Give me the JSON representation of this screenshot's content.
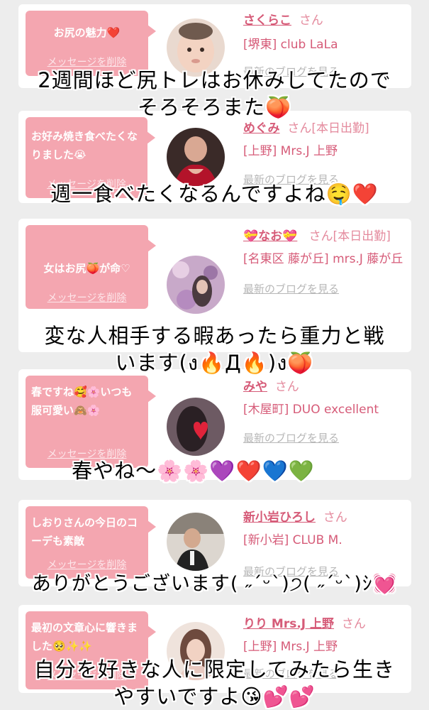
{
  "cards": [
    {
      "message": "お尻の魅力❤️",
      "delete_label": "メッセージを削除",
      "name": "さくらこ",
      "honorific": "さん",
      "shop": "[堺東] club LaLa",
      "blog_link": "最新のブログを見る",
      "avatar": "baby-photo",
      "overlay": "2週間ほど尻トレはお休みしてたので\nそろそろまた🍑"
    },
    {
      "message": "お好み焼き食べたくなりました😭",
      "delete_label": "メッセージを削除",
      "name": "めぐみ",
      "honorific": "さん[本日出勤]",
      "shop": "[上野] Mrs.J 上野",
      "blog_link": "最新のブログを見る",
      "avatar": "red-dress-photo",
      "overlay": "週一食べたくなるんですよね🤤❤️"
    },
    {
      "message": "女はお尻🍑が命♡",
      "delete_label": "メッセージを削除",
      "name": "💝なお💝",
      "honorific": "さん[本日出勤]",
      "shop": "[名東区 藤が丘] mrs.J 藤が丘",
      "blog_link": "最新のブログを見る",
      "avatar": "flower-photo",
      "overlay": "変な人相手する暇あったら重力と戦\nいます(ง🔥Д🔥)ง🍑"
    },
    {
      "message": "春ですね🥰🌸いつも服可愛い🙈🌸",
      "delete_label": "メッセージを削除",
      "name": "みや",
      "honorific": "さん",
      "shop": "[木屋町] DUO excellent",
      "blog_link": "最新のブログを見る",
      "avatar": "heart-photo",
      "overlay": "春やね〜🌸🌸💜❤️💙💚"
    },
    {
      "message": "しおりさんの今日のコーデも素敵",
      "delete_label": "メッセージを削除",
      "name": "新小岩ひろし",
      "honorific": "さん",
      "shop": "[新小岩] CLUB M.",
      "blog_link": "最新のブログを見る",
      "avatar": "man-photo",
      "overlay": "ありがとうございます( ˶ˊᵕˋ)੭( ˶ˊᵕˋ)ｼ💓"
    },
    {
      "message": "最初の文章心に響きました🥺✨✨",
      "delete_label": "メッセージを削除",
      "name": "りり Mrs.J 上野",
      "honorific": "さん",
      "shop": "[上野] Mrs.J 上野",
      "blog_link": "最新のブログを見る",
      "avatar": "woman-photo",
      "overlay": "自分を好きな人に限定してみたら生き\nやすいですよ😘💕💕"
    }
  ],
  "colors": {
    "bubble": "#f4a6b0",
    "name": "#d65b78",
    "background": "#ededed"
  }
}
